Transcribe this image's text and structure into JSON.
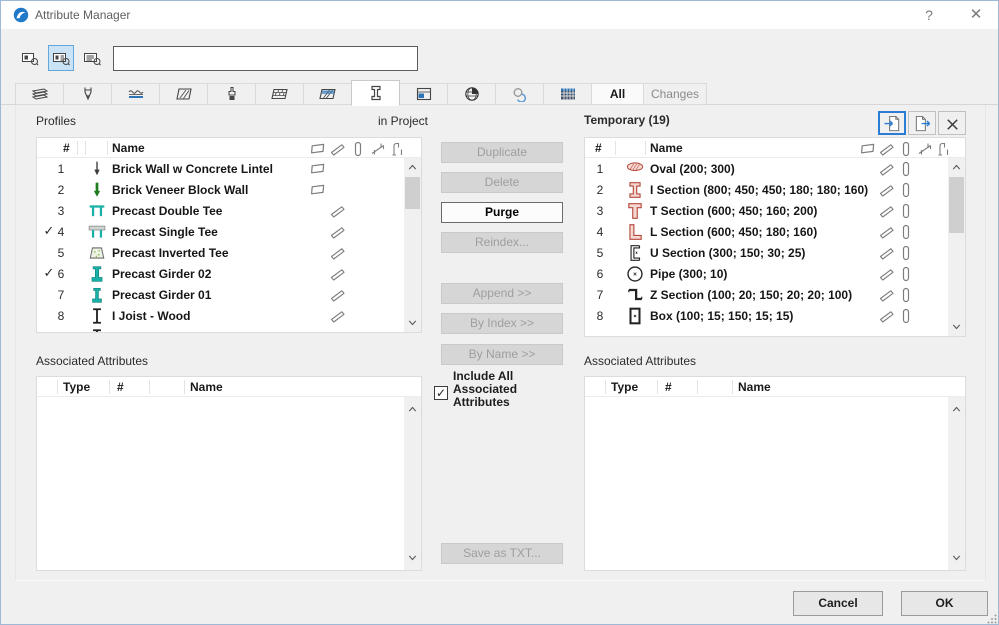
{
  "window": {
    "title": "Attribute Manager",
    "help_label": "?",
    "close_label": "✕"
  },
  "toolbar": {
    "search_value": "",
    "search_placeholder": ""
  },
  "tabs": {
    "icon_tabs": [
      {
        "name": "layers",
        "selected": false
      },
      {
        "name": "pens",
        "selected": false
      },
      {
        "name": "line-types",
        "selected": false
      },
      {
        "name": "fills",
        "selected": false
      },
      {
        "name": "surfaces",
        "selected": false
      },
      {
        "name": "composites",
        "selected": false
      },
      {
        "name": "building-materials",
        "selected": false
      },
      {
        "name": "profiles",
        "selected": true
      },
      {
        "name": "zones",
        "selected": false
      },
      {
        "name": "cities",
        "selected": false
      },
      {
        "name": "operation-profiles",
        "selected": false
      },
      {
        "name": "mep-systems",
        "selected": false
      }
    ],
    "all_label": "All",
    "changes_label": "Changes"
  },
  "left_panel": {
    "title": "Profiles",
    "scope_label": "in Project",
    "columns": {
      "num": "#",
      "name": "Name"
    },
    "usage_header": [
      "wall",
      "beam",
      "column",
      "curtain-wall",
      "railing"
    ],
    "rows": [
      {
        "checked": false,
        "num": "1",
        "icon": "arrow-thin",
        "name": "Brick Wall w Concrete Lintel",
        "usage": [
          "wall"
        ]
      },
      {
        "checked": false,
        "num": "2",
        "icon": "arrow-green",
        "name": "Brick Veneer Block Wall",
        "usage": [
          "wall"
        ]
      },
      {
        "checked": false,
        "num": "3",
        "icon": "double-tee",
        "name": "Precast Double Tee",
        "usage": [
          "beam"
        ]
      },
      {
        "checked": true,
        "num": "4",
        "icon": "single-tee",
        "name": "Precast Single Tee",
        "usage": [
          "beam"
        ]
      },
      {
        "checked": false,
        "num": "5",
        "icon": "inverted-tee",
        "name": "Precast Inverted Tee",
        "usage": [
          "beam"
        ]
      },
      {
        "checked": true,
        "num": "6",
        "icon": "girder-a",
        "name": "Precast Girder 02",
        "usage": [
          "beam"
        ]
      },
      {
        "checked": false,
        "num": "7",
        "icon": "girder-b",
        "name": "Precast Girder 01",
        "usage": [
          "beam"
        ]
      },
      {
        "checked": false,
        "num": "8",
        "icon": "i-joist",
        "name": "I Joist - Wood",
        "usage": [
          "beam"
        ]
      }
    ],
    "partial_row": {
      "icon": "i-joist",
      "usage": [
        "beam"
      ]
    }
  },
  "right_panel": {
    "title": "Temporary (19)",
    "columns": {
      "num": "#",
      "name": "Name"
    },
    "usage_header": [
      "wall",
      "beam",
      "column",
      "curtain-wall",
      "railing"
    ],
    "rows": [
      {
        "num": "1",
        "icon": "oval",
        "name": "Oval (200; 300)",
        "usage": [
          "beam",
          "column"
        ]
      },
      {
        "num": "2",
        "icon": "i-section",
        "name": "I Section (800; 450; 450; 180; 180; 160)",
        "usage": [
          "beam",
          "column"
        ]
      },
      {
        "num": "3",
        "icon": "t-section",
        "name": "T Section (600; 450; 160; 200)",
        "usage": [
          "beam",
          "column"
        ]
      },
      {
        "num": "4",
        "icon": "l-section",
        "name": "L Section (600; 450; 180; 160)",
        "usage": [
          "beam",
          "column"
        ]
      },
      {
        "num": "5",
        "icon": "u-section",
        "name": "U Section (300; 150; 30; 25)",
        "usage": [
          "beam",
          "column"
        ]
      },
      {
        "num": "6",
        "icon": "pipe",
        "name": "Pipe (300; 10)",
        "usage": [
          "beam",
          "column"
        ]
      },
      {
        "num": "7",
        "icon": "z-section",
        "name": "Z Section (100; 20; 150; 20; 20; 100)",
        "usage": [
          "beam",
          "column"
        ]
      },
      {
        "num": "8",
        "icon": "box",
        "name": "Box (100; 15; 150; 15; 15)",
        "usage": [
          "beam",
          "column"
        ]
      }
    ]
  },
  "actions": {
    "duplicate": "Duplicate",
    "delete": "Delete",
    "purge": "Purge",
    "reindex": "Reindex...",
    "append": "Append >>",
    "by_index": "By Index >>",
    "by_name": "By Name >>",
    "include_all_label": "Include All Associated Attributes",
    "include_all_checked": true,
    "check_glyph": "✓",
    "save_txt": "Save as TXT..."
  },
  "assoc": {
    "title": "Associated Attributes",
    "columns": {
      "type": "Type",
      "num": "#",
      "name": "Name"
    }
  },
  "footer": {
    "cancel": "Cancel",
    "ok": "OK"
  },
  "colors": {
    "accent": "#2b7cd3",
    "teal": "#19b0a8",
    "profile_red": "#b5493c",
    "arrow_green": "#1e7d1e"
  }
}
